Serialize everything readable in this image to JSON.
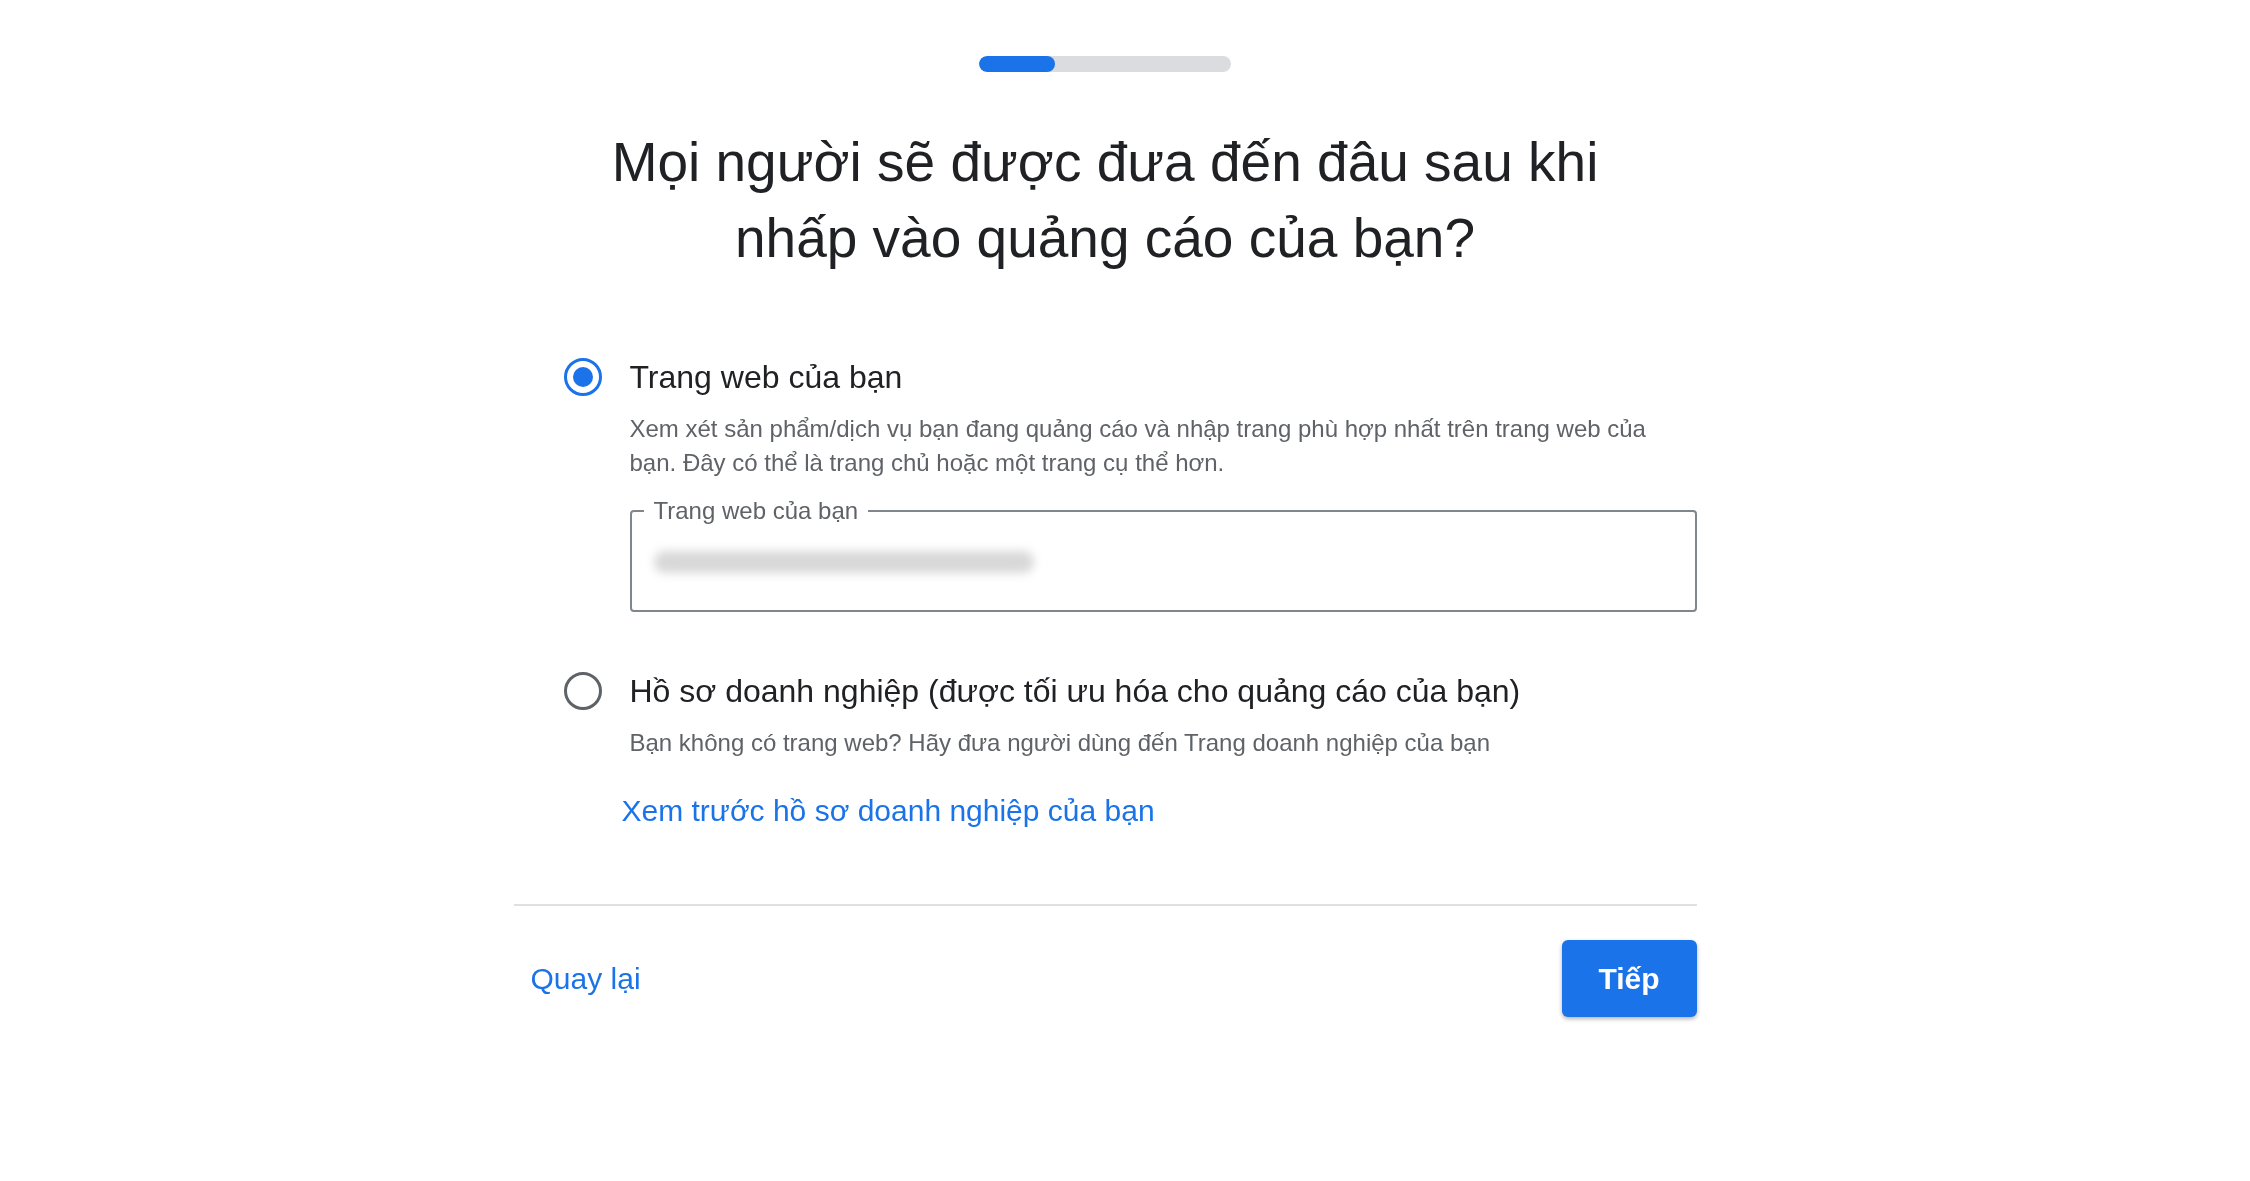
{
  "progress": {
    "level": 0.3
  },
  "title": "Mọi người sẽ được đưa đến đâu sau khi nhấp vào quảng cáo của bạn?",
  "options": [
    {
      "label": "Trang web của bạn",
      "description": "Xem xét sản phẩm/dịch vụ bạn đang quảng cáo và nhập trang phù hợp nhất trên trang web của bạn. Đây có thể là trang chủ hoặc một trang cụ thể hơn.",
      "selected": true,
      "field": {
        "label": "Trang web của bạn"
      }
    },
    {
      "label": "Hồ sơ doanh nghiệp (được tối ưu hóa cho quảng cáo của bạn)",
      "description": "Bạn không có trang web? Hãy đưa người dùng đến Trang doanh nghiệp của bạn",
      "selected": false,
      "link": "Xem trước hồ sơ doanh nghiệp của bạn"
    }
  ],
  "footer": {
    "back": "Quay lại",
    "next": "Tiếp"
  }
}
